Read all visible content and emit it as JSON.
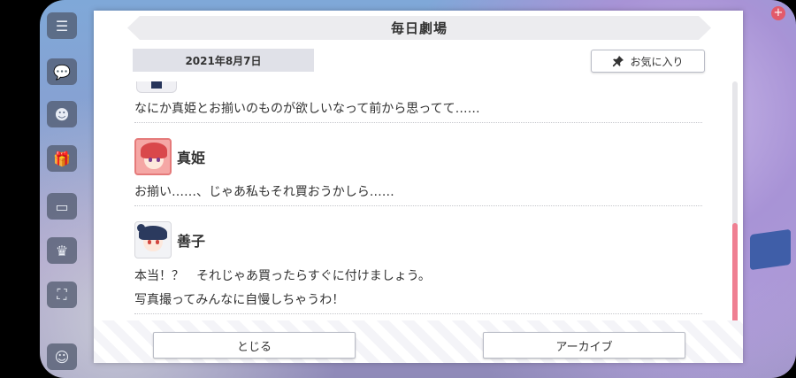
{
  "header": {
    "title": "毎日劇場"
  },
  "date": "2021年8月7日",
  "favorite": {
    "label": "お気に入り",
    "icon": "pin-icon"
  },
  "dialogue": {
    "first_line": "なにか真姫とお揃いのものが欲しいなって前から思ってて……",
    "entries": [
      {
        "speaker": "真姫",
        "lines": [
          "お揃い……、じゃあ私もそれ買おうかしら……"
        ]
      },
      {
        "speaker": "善子",
        "lines": [
          "本当！？　それじゃあ買ったらすぐに付けましょう。",
          "写真撮ってみんなに自慢しちゃうわ！"
        ]
      }
    ]
  },
  "footer": {
    "close_label": "とじる",
    "archive_label": "アーカイブ"
  },
  "colors": {
    "accent_scroll": "#ef7f92",
    "title_bg": "#ececef",
    "date_bg": "#e0e1e8"
  }
}
